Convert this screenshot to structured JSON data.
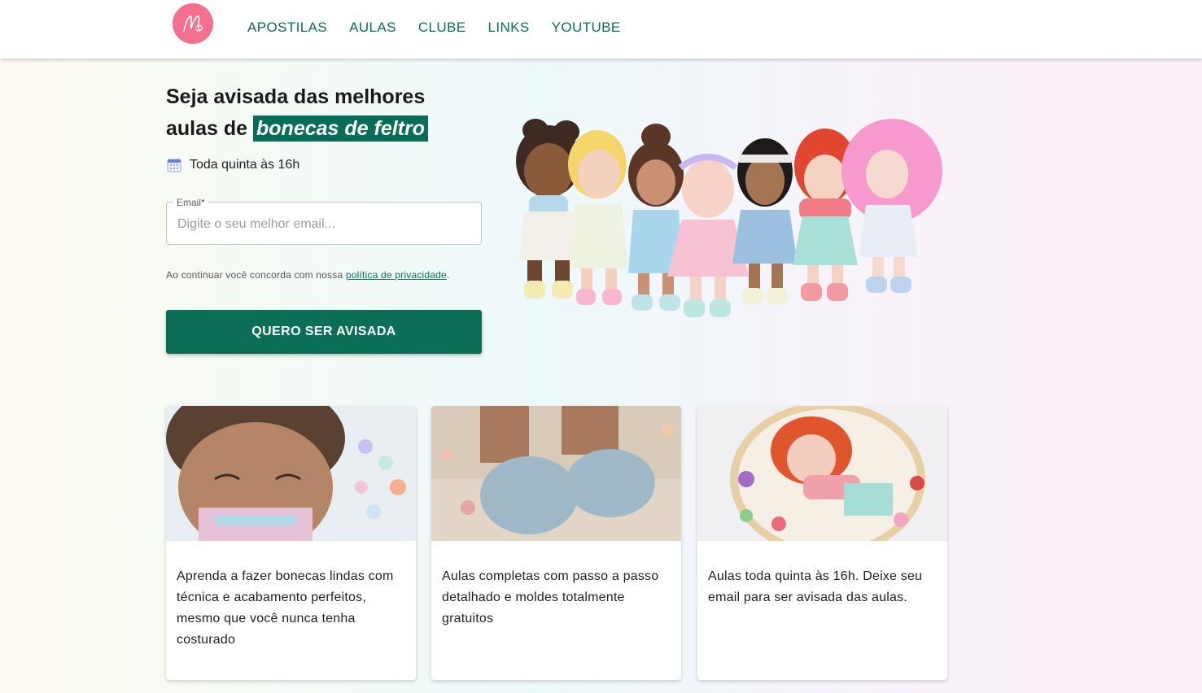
{
  "header": {
    "logo_letter": "M",
    "nav": [
      "APOSTILAS",
      "AULAS",
      "CLUBE",
      "LINKS",
      "YOUTUBE"
    ]
  },
  "signup": {
    "headline_line1": "Seja avisada das melhores",
    "headline_prefix": "aulas de",
    "headline_highlight": "bonecas de feltro",
    "schedule": "Toda quinta às 16h",
    "email_label": "Email",
    "email_required_mark": "*",
    "email_placeholder": "Digite o seu melhor email...",
    "email_value": "",
    "consent_text": "Ao continuar você concorda com nossa",
    "consent_link": "política de privacidade",
    "consent_end": ".",
    "cta_label": "QUERO SER AVISADA"
  },
  "cards": [
    {
      "text": "Aprenda a fazer bonecas lindas com técnica e acabamento perfeitos, mesmo que você nunca tenha costurado"
    },
    {
      "text": "Aulas completas com passo a passo detalhado e moldes totalmente gratuitos"
    },
    {
      "text": "Aulas toda quinta às 16h. Deixe seu email para ser avisada das aulas."
    }
  ],
  "colors": {
    "brand_green": "#0b6f58",
    "logo_pink": "#f4708f"
  }
}
